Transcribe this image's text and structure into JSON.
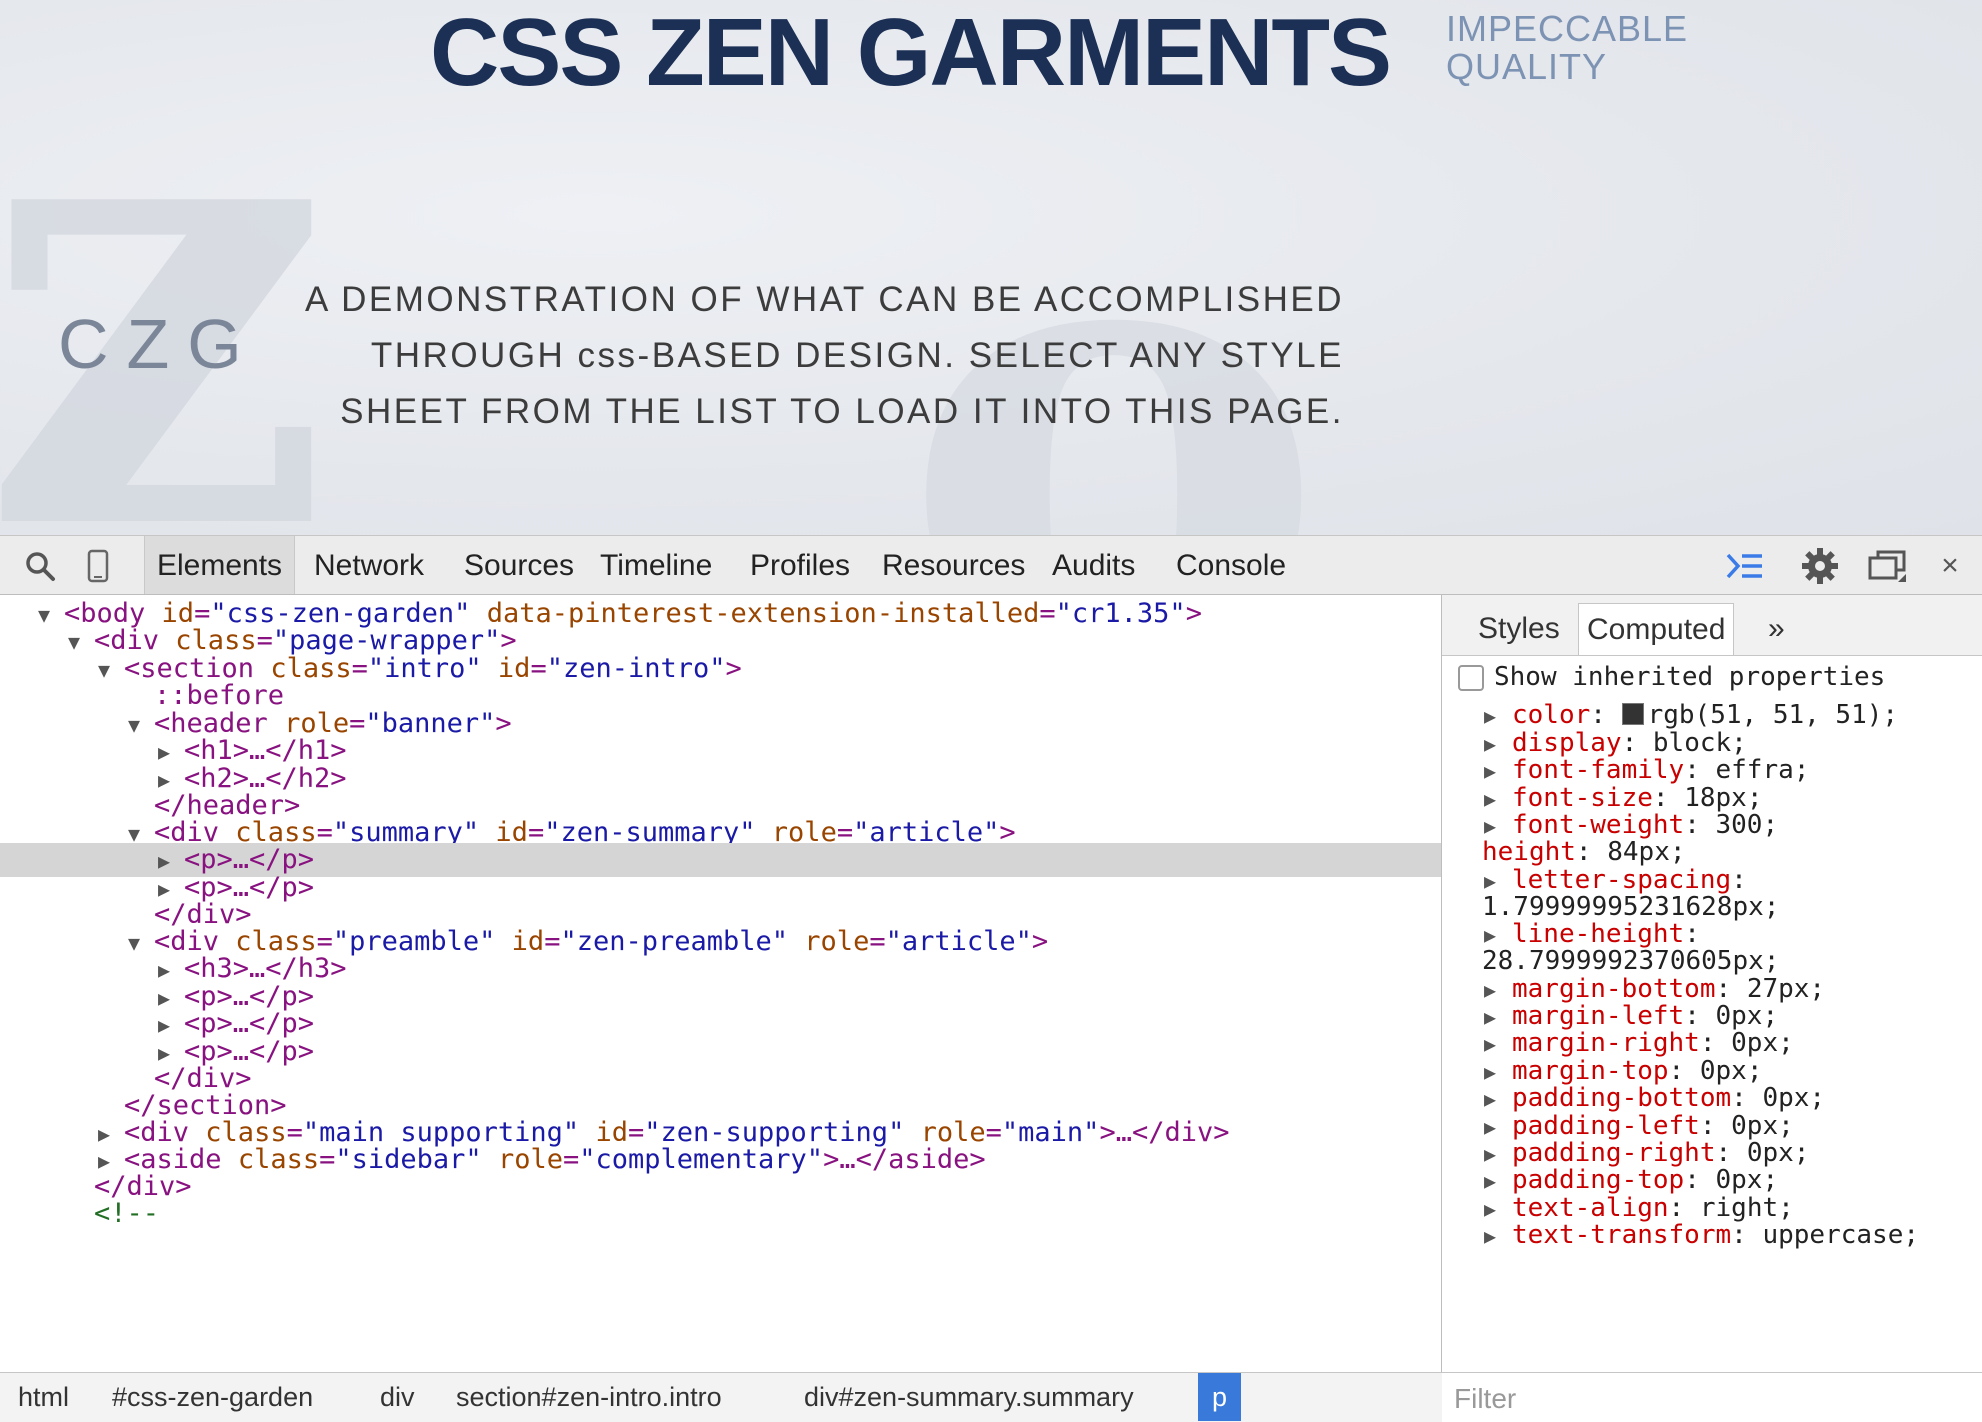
{
  "preview": {
    "site_title": "CSS ZEN GARMENTS",
    "tagline": "IMPECCABLE QUALITY",
    "logo": "CZG",
    "summary": "A DEMONSTRATION OF WHAT CAN BE ACCOMPLISHED THROUGH css-BASED DESIGN. SELECT ANY STYLE SHEET FROM THE LIST TO LOAD IT INTO THIS PAGE."
  },
  "toolbar": {
    "tabs": [
      "Elements",
      "Network",
      "Sources",
      "Timeline",
      "Profiles",
      "Resources",
      "Audits",
      "Console"
    ],
    "active_tab": "Elements",
    "icons": [
      "search-icon",
      "device-icon",
      "drawer-icon",
      "gear-icon",
      "dock-icon",
      "close-icon"
    ],
    "close_label": "×"
  },
  "dom": {
    "lines": {
      "body": {
        "open": "<body",
        "a1": "id",
        "v1": "\"css-zen-garden\"",
        "a2": "data-pinterest-extension-installed",
        "v2": "\"cr1.35\"",
        "close": ">"
      },
      "wrapper": {
        "open": "<div",
        "a1": "class",
        "v1": "\"page-wrapper\"",
        "close": ">"
      },
      "section": {
        "open": "<section",
        "a1": "class",
        "v1": "\"intro\"",
        "a2": "id",
        "v2": "\"zen-intro\"",
        "close": ">"
      },
      "before": "::before",
      "header": {
        "open": "<header",
        "a1": "role",
        "v1": "\"banner\"",
        "close": ">"
      },
      "h1": "<h1>…</h1>",
      "h2": "<h2>…</h2>",
      "header_end": "</header>",
      "summary": {
        "open": "<div",
        "a1": "class",
        "v1": "\"summary\"",
        "a2": "id",
        "v2": "\"zen-summary\"",
        "a3": "role",
        "v3": "\"article\"",
        "close": ">"
      },
      "p1": "<p>…</p>",
      "p2": "<p>…</p>",
      "summary_end": "</div>",
      "preamble": {
        "open": "<div",
        "a1": "class",
        "v1": "\"preamble\"",
        "a2": "id",
        "v2": "\"zen-preamble\"",
        "a3": "role",
        "v3": "\"article\"",
        "close": ">"
      },
      "h3": "<h3>…</h3>",
      "p3": "<p>…</p>",
      "p4": "<p>…</p>",
      "p5": "<p>…</p>",
      "preamble_end": "</div>",
      "section_end": "</section>",
      "supporting": {
        "open": "<div",
        "a1": "class",
        "v1": "\"main supporting\"",
        "a2": "id",
        "v2": "\"zen-supporting\"",
        "a3": "role",
        "v3": "\"main\"",
        "close": ">…</div>"
      },
      "aside": {
        "open": "<aside",
        "a1": "class",
        "v1": "\"sidebar\"",
        "a2": "role",
        "v2": "\"complementary\"",
        "close": ">…</aside>"
      },
      "wrapper_end": "</div>",
      "partial": "<!--"
    }
  },
  "breadcrumb": [
    "html",
    "#css-zen-garden",
    "div",
    "section#zen-intro.intro",
    "div#zen-summary.summary",
    "p"
  ],
  "sidebar": {
    "tabs": [
      "Styles",
      "Computed"
    ],
    "active_tab": "Computed",
    "more_label": "»",
    "show_inherited_label": "Show inherited properties",
    "properties": [
      {
        "name": "color",
        "value": "rgb(51, 51, 51);",
        "swatch": "#333333"
      },
      {
        "name": "display",
        "value": "block;"
      },
      {
        "name": "font-family",
        "value": "effra;"
      },
      {
        "name": "font-size",
        "value": "18px;"
      },
      {
        "name": "font-weight",
        "value": "300;"
      },
      {
        "name": "height",
        "value": "84px;"
      },
      {
        "name": "letter-spacing",
        "value": "1.79999995231628px;"
      },
      {
        "name": "line-height",
        "value": "28.7999992370605px;"
      },
      {
        "name": "margin-bottom",
        "value": "27px;"
      },
      {
        "name": "margin-left",
        "value": "0px;"
      },
      {
        "name": "margin-right",
        "value": "0px;"
      },
      {
        "name": "margin-top",
        "value": "0px;"
      },
      {
        "name": "padding-bottom",
        "value": "0px;"
      },
      {
        "name": "padding-left",
        "value": "0px;"
      },
      {
        "name": "padding-right",
        "value": "0px;"
      },
      {
        "name": "padding-top",
        "value": "0px;"
      },
      {
        "name": "text-align",
        "value": "right;"
      },
      {
        "name": "text-transform",
        "value": "uppercase;"
      }
    ],
    "filter_placeholder": "Filter"
  },
  "colors": {
    "title": "#1c2f55",
    "tagline": "#7d93b4",
    "tag": "#881280",
    "attr_name": "#994500",
    "attr_value": "#1a1aa6",
    "prop_name": "#c80000",
    "selection": "#d5d5d5",
    "active_crumb": "#3879d9"
  }
}
